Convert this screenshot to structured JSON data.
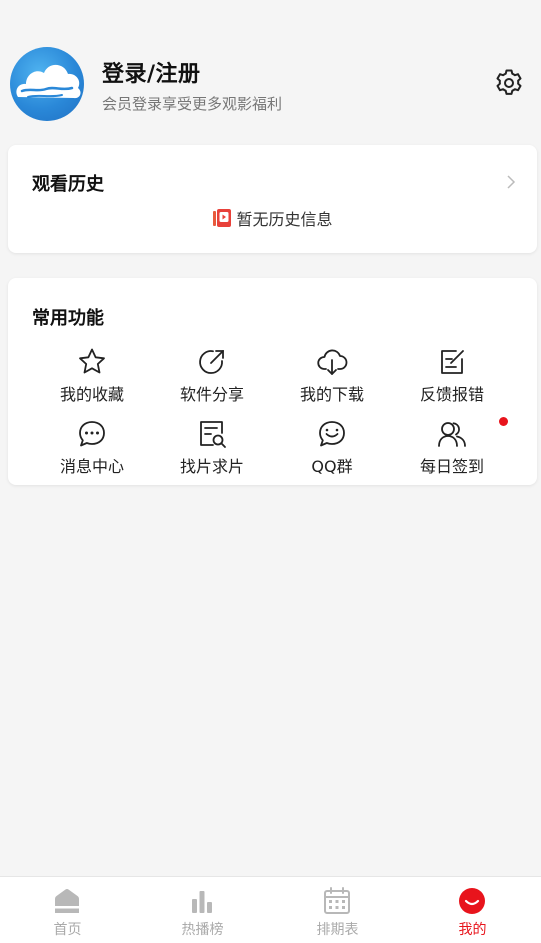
{
  "profile": {
    "title": "登录/注册",
    "subtitle": "会员登录享受更多观影福利",
    "avatar_icon": "cloud-logo-icon",
    "settings_icon": "gear-icon"
  },
  "history": {
    "title": "观看历史",
    "empty_text": "暂无历史信息",
    "chevron_icon": "chevron-right-icon",
    "empty_icon": "book-icon"
  },
  "functions": {
    "title": "常用功能",
    "items": [
      {
        "label": "我的收藏",
        "icon": "star-icon"
      },
      {
        "label": "软件分享",
        "icon": "share-icon"
      },
      {
        "label": "我的下载",
        "icon": "cloud-download-icon"
      },
      {
        "label": "反馈报错",
        "icon": "edit-icon"
      },
      {
        "label": "消息中心",
        "icon": "message-icon"
      },
      {
        "label": "找片求片",
        "icon": "search-doc-icon"
      },
      {
        "label": "QQ群",
        "icon": "chat-icon"
      },
      {
        "label": "每日签到",
        "icon": "users-icon"
      }
    ]
  },
  "tabbar": {
    "tabs": [
      {
        "label": "首页",
        "icon": "home-icon"
      },
      {
        "label": "热播榜",
        "icon": "bar-chart-icon"
      },
      {
        "label": "排期表",
        "icon": "calendar-icon"
      },
      {
        "label": "我的",
        "icon": "smile-icon"
      }
    ],
    "active_index": 3
  },
  "colors": {
    "accent": "#e8141c",
    "inactive": "#aaaaaa",
    "background": "#f5f5f5"
  }
}
